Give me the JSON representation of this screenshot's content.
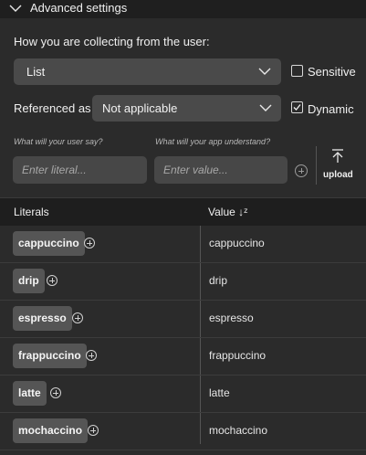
{
  "header": {
    "title": "Advanced settings",
    "icon": "chevron-down-icon"
  },
  "collection": {
    "label": "How you are collecting from the user:",
    "selected": "List"
  },
  "sensitive": {
    "label": "Sensitive",
    "checked": false
  },
  "reference": {
    "label": "Referenced as",
    "selected": "Not applicable"
  },
  "dynamic": {
    "label": "Dynamic",
    "checked": true
  },
  "hints": {
    "literal": "What will your user say?",
    "value": "What will your app understand?"
  },
  "inputs": {
    "literal_placeholder": "Enter literal...",
    "value_placeholder": "Enter value..."
  },
  "upload": {
    "label": "upload"
  },
  "table": {
    "col_literals": "Literals",
    "col_value": "Value ↓ᶻ",
    "rows": [
      {
        "literal": "cappuccino",
        "value": "cappuccino"
      },
      {
        "literal": "drip",
        "value": "drip"
      },
      {
        "literal": "espresso",
        "value": "espresso"
      },
      {
        "literal": "frappuccino",
        "value": "frappuccino"
      },
      {
        "literal": "latte",
        "value": "latte"
      },
      {
        "literal": "mochaccino",
        "value": "mochaccino"
      }
    ]
  }
}
